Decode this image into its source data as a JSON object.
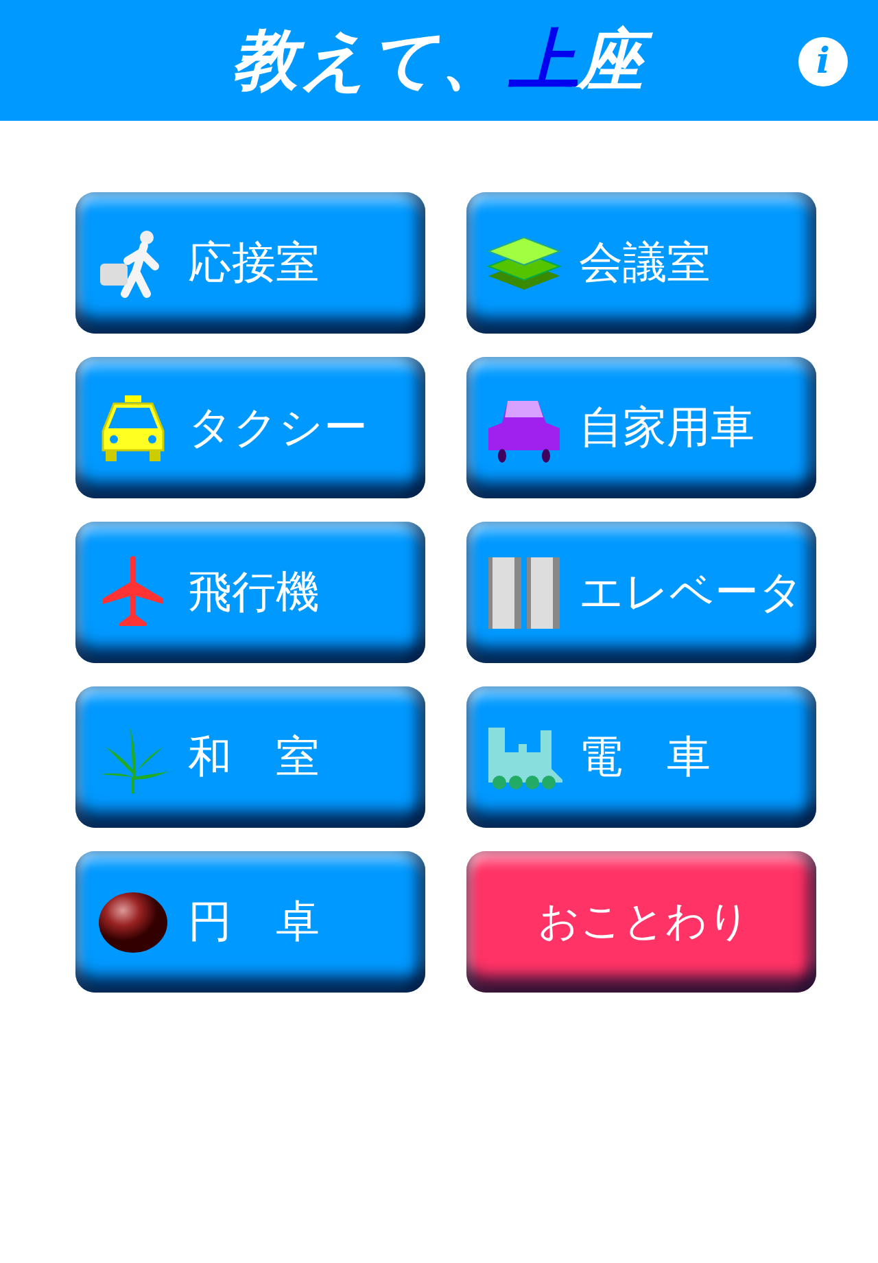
{
  "header": {
    "title_parts": [
      {
        "text": "教えて、",
        "highlight": false
      },
      {
        "text": "上",
        "highlight": true
      },
      {
        "text": "座",
        "highlight": false
      }
    ],
    "info_button": "i"
  },
  "buttons": [
    {
      "label": "応接室",
      "kind": "option"
    },
    {
      "label": "会議室",
      "kind": "option"
    },
    {
      "label": "タクシー",
      "kind": "option"
    },
    {
      "label": "自家用車",
      "kind": "option"
    },
    {
      "label": "飛行機",
      "kind": "option"
    },
    {
      "label": "エレベータ",
      "kind": "option"
    },
    {
      "label": "和　室",
      "kind": "option"
    },
    {
      "label": "電　車",
      "kind": "option"
    },
    {
      "label": "円　卓",
      "kind": "option"
    },
    {
      "label": "おことわり",
      "kind": "cancel"
    }
  ]
}
